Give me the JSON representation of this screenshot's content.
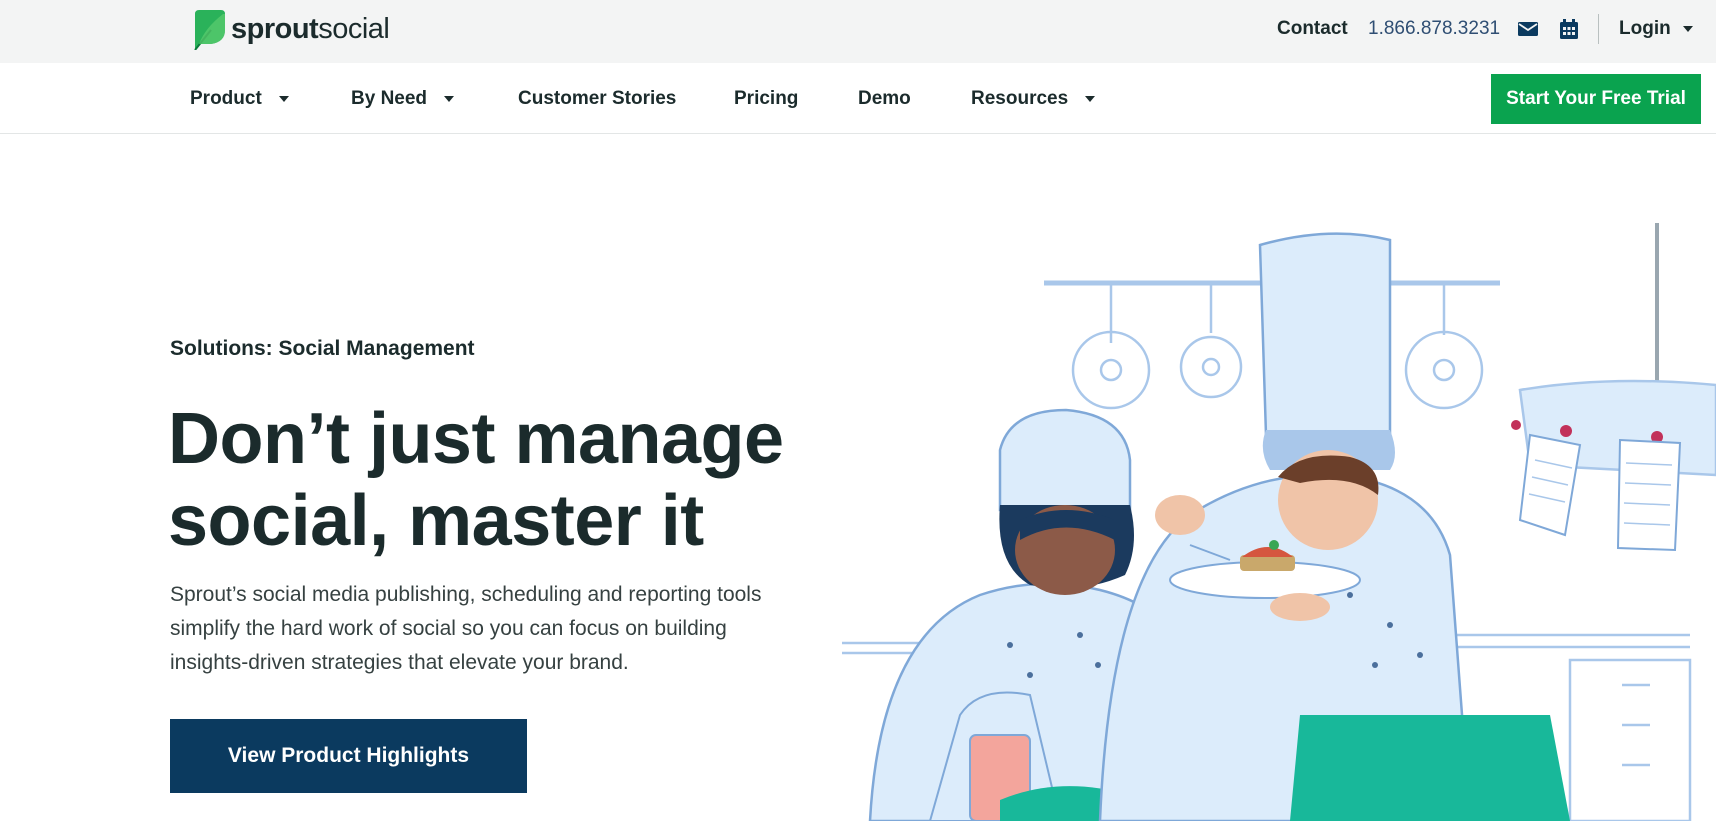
{
  "brand": {
    "name_bold": "sprout",
    "name_light": "social",
    "color": "#0aa34f"
  },
  "utility_bar": {
    "contact_label": "Contact",
    "phone": "1.866.878.3231",
    "mail_icon": "envelope-icon",
    "calendar_icon": "calendar-icon",
    "login_label": "Login"
  },
  "nav": {
    "items": [
      {
        "label": "Product",
        "has_dropdown": true
      },
      {
        "label": "By Need",
        "has_dropdown": true
      },
      {
        "label": "Customer Stories",
        "has_dropdown": false
      },
      {
        "label": "Pricing",
        "has_dropdown": false
      },
      {
        "label": "Demo",
        "has_dropdown": false
      },
      {
        "label": "Resources",
        "has_dropdown": true
      }
    ],
    "cta_label": "Start Your Free Trial"
  },
  "hero": {
    "eyebrow": "Solutions: Social Management",
    "headline_line1": "Don’t just manage",
    "headline_line2": "social, master it",
    "body": "Sprout’s social media publishing, scheduling and reporting tools simplify the hard work of social so you can focus on building insights-driven strategies that elevate your brand.",
    "cta_label": "View Product Highlights"
  },
  "colors": {
    "accent_green": "#0aa34f",
    "navy": "#0b3a5f",
    "text": "#1b2b2c",
    "illustration_blue": "#dcecfb",
    "illustration_outline": "#7fa8d8",
    "apron_teal": "#18b89a"
  }
}
